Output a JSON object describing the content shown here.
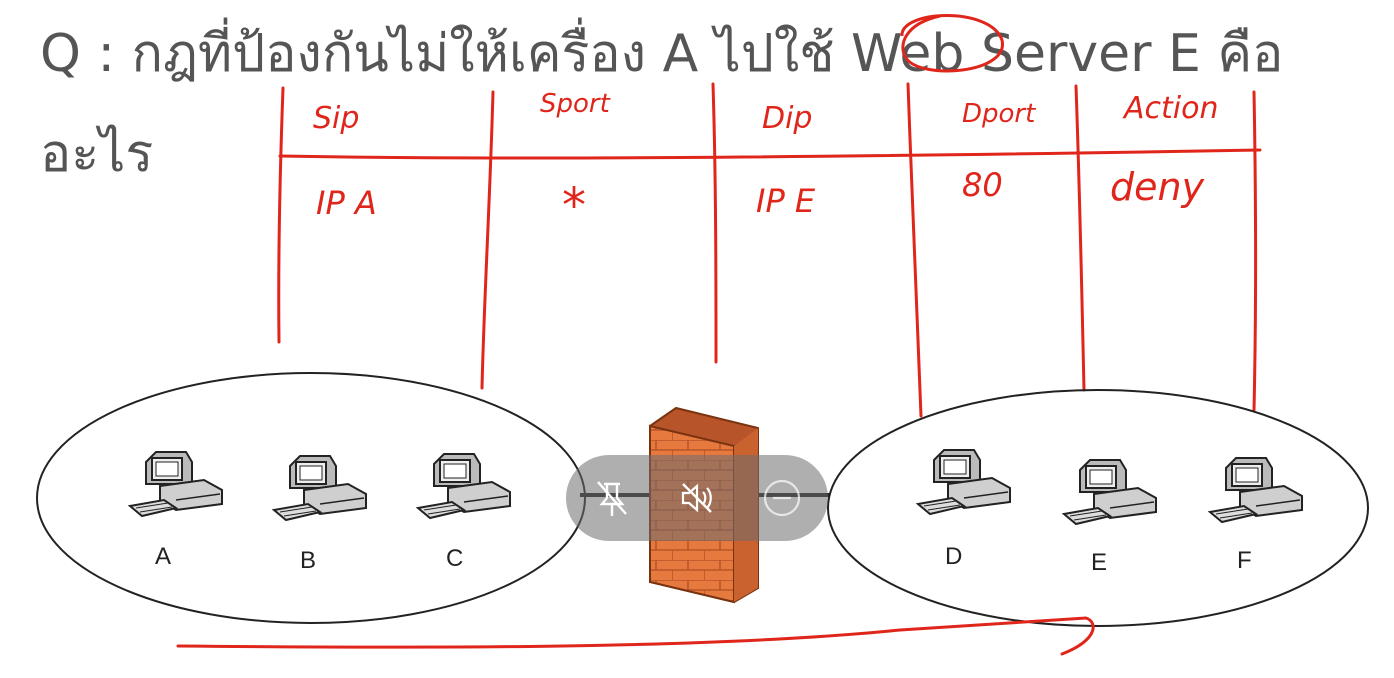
{
  "question": {
    "line1": "Q : กฎที่ป้องกันไม่ให้เครื่อง A ไปใช้ Web Server E คือ",
    "line2": "อะไร"
  },
  "annotation_table": {
    "headers": [
      "Sip",
      "Sport",
      "Dip",
      "Dport",
      "Action"
    ],
    "row": [
      "IP A",
      "*",
      "IP E",
      "80",
      "deny"
    ]
  },
  "networks": {
    "left_hosts": [
      "A",
      "B",
      "C"
    ],
    "right_hosts": [
      "D",
      "E",
      "F"
    ]
  },
  "firewall": {
    "icon": "firewall-brick-icon"
  },
  "controls": {
    "pin": "unpin-icon",
    "mute": "mute-icon",
    "stop": "minus-circle-icon"
  },
  "colors": {
    "ink": "#e0251b",
    "question_text": "#555555",
    "brick": "#e6793e"
  }
}
